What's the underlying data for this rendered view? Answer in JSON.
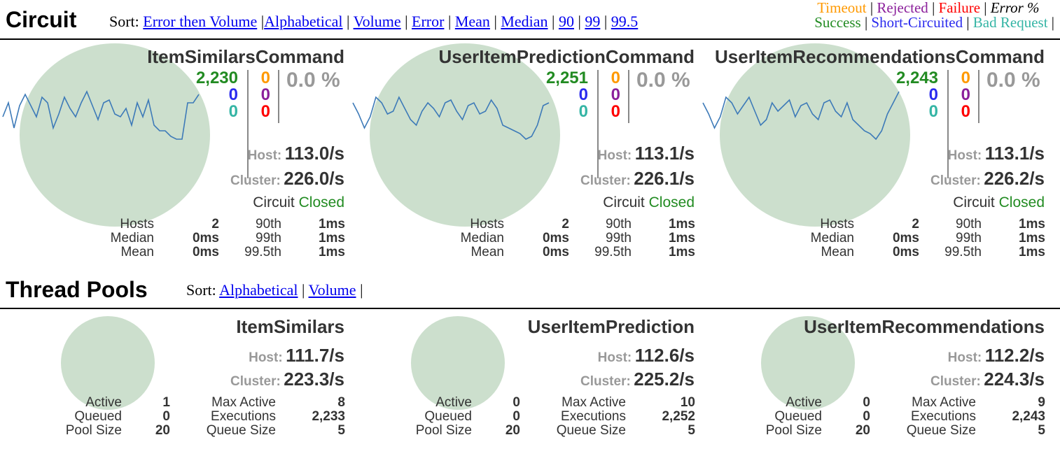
{
  "circuit_section": {
    "title": "Circuit",
    "sort_label": "Sort:",
    "sort_links": [
      "Error then Volume",
      "Alphabetical",
      "Volume",
      "Error",
      "Mean",
      "Median",
      "90",
      "99",
      "99.5"
    ],
    "legend": {
      "timeout": "Timeout",
      "rejected": "Rejected",
      "failure": "Failure",
      "error_pct": "Error %",
      "success": "Success",
      "short_circuited": "Short-Circuited",
      "bad_request": "Bad Request",
      "sep": "|"
    },
    "circuits": [
      {
        "name": "ItemSimilarsCommand",
        "success": "2,230",
        "short_circuited": "0",
        "bad_request": "0",
        "timeout": "0",
        "rejected": "0",
        "failure": "0",
        "error_pct": "0.0 %",
        "host_label": "Host:",
        "host_rate": "113.0/s",
        "cluster_label": "Cluster:",
        "cluster_rate": "226.0/s",
        "circuit_label": "Circuit",
        "circuit_state": "Closed",
        "hosts_label": "Hosts",
        "hosts": "2",
        "median_label": "Median",
        "median": "0ms",
        "mean_label": "Mean",
        "mean": "0ms",
        "p90_label": "90th",
        "p90": "1ms",
        "p99_label": "99th",
        "p99": "1ms",
        "p995_label": "99.5th",
        "p995": "1ms",
        "sparkline": [
          0.55,
          0.3,
          0.75,
          0.35,
          0.15,
          0.35,
          0.55,
          0.2,
          0.3,
          0.75,
          0.5,
          0.2,
          0.4,
          0.55,
          0.3,
          0.1,
          0.35,
          0.6,
          0.3,
          0.25,
          0.5,
          0.55,
          0.4,
          0.7,
          0.3,
          0.55,
          0.25,
          0.7,
          0.8,
          0.8,
          0.9,
          0.95,
          0.95,
          0.3,
          0.3,
          0.15
        ]
      },
      {
        "name": "UserItemPredictionCommand",
        "success": "2,251",
        "short_circuited": "0",
        "bad_request": "0",
        "timeout": "0",
        "rejected": "0",
        "failure": "0",
        "error_pct": "0.0 %",
        "host_label": "Host:",
        "host_rate": "113.1/s",
        "cluster_label": "Cluster:",
        "cluster_rate": "226.1/s",
        "circuit_label": "Circuit",
        "circuit_state": "Closed",
        "hosts_label": "Hosts",
        "hosts": "2",
        "median_label": "Median",
        "median": "0ms",
        "mean_label": "Mean",
        "mean": "0ms",
        "p90_label": "90th",
        "p90": "1ms",
        "p99_label": "99th",
        "p99": "1ms",
        "p995_label": "99.5th",
        "p995": "1ms",
        "sparkline": [
          0.3,
          0.5,
          0.75,
          0.55,
          0.2,
          0.3,
          0.5,
          0.45,
          0.2,
          0.4,
          0.6,
          0.7,
          0.45,
          0.3,
          0.4,
          0.55,
          0.3,
          0.25,
          0.45,
          0.6,
          0.35,
          0.3,
          0.5,
          0.45,
          0.25,
          0.4,
          0.7,
          0.75,
          0.8,
          0.85,
          0.95,
          0.9,
          0.7,
          0.35,
          0.3
        ]
      },
      {
        "name": "UserItemRecommendationsCommand",
        "success": "2,243",
        "short_circuited": "0",
        "bad_request": "0",
        "timeout": "0",
        "rejected": "0",
        "failure": "0",
        "error_pct": "0.0 %",
        "host_label": "Host:",
        "host_rate": "113.1/s",
        "cluster_label": "Cluster:",
        "cluster_rate": "226.2/s",
        "circuit_label": "Circuit",
        "circuit_state": "Closed",
        "hosts_label": "Hosts",
        "hosts": "2",
        "median_label": "Median",
        "median": "0ms",
        "mean_label": "Mean",
        "mean": "0ms",
        "p90_label": "90th",
        "p90": "1ms",
        "p99_label": "99th",
        "p99": "1ms",
        "p995_label": "99.5th",
        "p995": "1ms",
        "sparkline": [
          0.3,
          0.5,
          0.75,
          0.55,
          0.2,
          0.3,
          0.5,
          0.35,
          0.2,
          0.45,
          0.7,
          0.6,
          0.3,
          0.45,
          0.35,
          0.25,
          0.55,
          0.35,
          0.3,
          0.5,
          0.6,
          0.3,
          0.25,
          0.45,
          0.55,
          0.3,
          0.6,
          0.7,
          0.8,
          0.85,
          0.95,
          0.8,
          0.5,
          0.3,
          0.1
        ]
      }
    ]
  },
  "threadpool_section": {
    "title": "Thread Pools",
    "sort_label": "Sort:",
    "sort_links": [
      "Alphabetical",
      "Volume"
    ],
    "pools": [
      {
        "name": "ItemSimilars",
        "host_label": "Host:",
        "host_rate": "111.7/s",
        "cluster_label": "Cluster:",
        "cluster_rate": "223.3/s",
        "active_label": "Active",
        "active": "1",
        "queued_label": "Queued",
        "queued": "0",
        "pool_size_label": "Pool Size",
        "pool_size": "20",
        "max_active_label": "Max Active",
        "max_active": "8",
        "executions_label": "Executions",
        "executions": "2,233",
        "queue_size_label": "Queue Size",
        "queue_size": "5"
      },
      {
        "name": "UserItemPrediction",
        "host_label": "Host:",
        "host_rate": "112.6/s",
        "cluster_label": "Cluster:",
        "cluster_rate": "225.2/s",
        "active_label": "Active",
        "active": "0",
        "queued_label": "Queued",
        "queued": "0",
        "pool_size_label": "Pool Size",
        "pool_size": "20",
        "max_active_label": "Max Active",
        "max_active": "10",
        "executions_label": "Executions",
        "executions": "2,252",
        "queue_size_label": "Queue Size",
        "queue_size": "5"
      },
      {
        "name": "UserItemRecommendations",
        "host_label": "Host:",
        "host_rate": "112.2/s",
        "cluster_label": "Cluster:",
        "cluster_rate": "224.3/s",
        "active_label": "Active",
        "active": "0",
        "queued_label": "Queued",
        "queued": "0",
        "pool_size_label": "Pool Size",
        "pool_size": "20",
        "max_active_label": "Max Active",
        "max_active": "9",
        "executions_label": "Executions",
        "executions": "2,243",
        "queue_size_label": "Queue Size",
        "queue_size": "5"
      }
    ]
  }
}
